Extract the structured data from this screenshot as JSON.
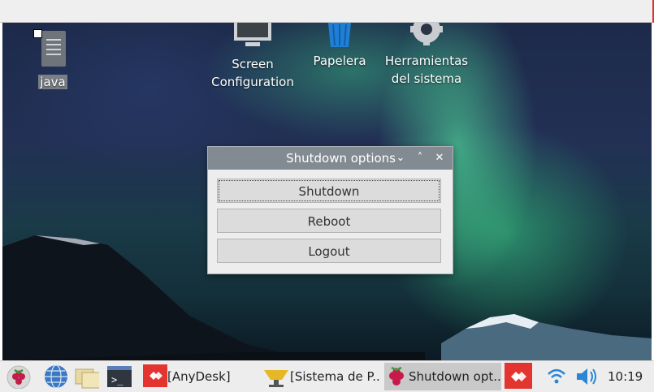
{
  "desktop": {
    "icons": [
      {
        "label": "java"
      },
      {
        "label_line1": "Screen",
        "label_line2": "Configuration"
      },
      {
        "label": "Papelera"
      },
      {
        "label_line1": "Herramientas",
        "label_line2": "del sistema"
      }
    ]
  },
  "dialog": {
    "title": "Shutdown options",
    "buttons": {
      "shutdown": "Shutdown",
      "reboot": "Reboot",
      "logout": "Logout"
    }
  },
  "taskbar": {
    "tasks": [
      {
        "label": "[AnyDesk]"
      },
      {
        "label": "[Sistema de P..."
      },
      {
        "label": "Shutdown opt..."
      }
    ],
    "clock": "10:19"
  },
  "colors": {
    "anydesk_red": "#e3342f",
    "raspberry": "#c51a4a",
    "titlebar": "#838b92"
  },
  "icons": [
    "raspberry-menu-icon",
    "browser-globe-icon",
    "file-manager-icon",
    "terminal-icon",
    "anydesk-icon",
    "wifi-icon",
    "volume-icon"
  ]
}
